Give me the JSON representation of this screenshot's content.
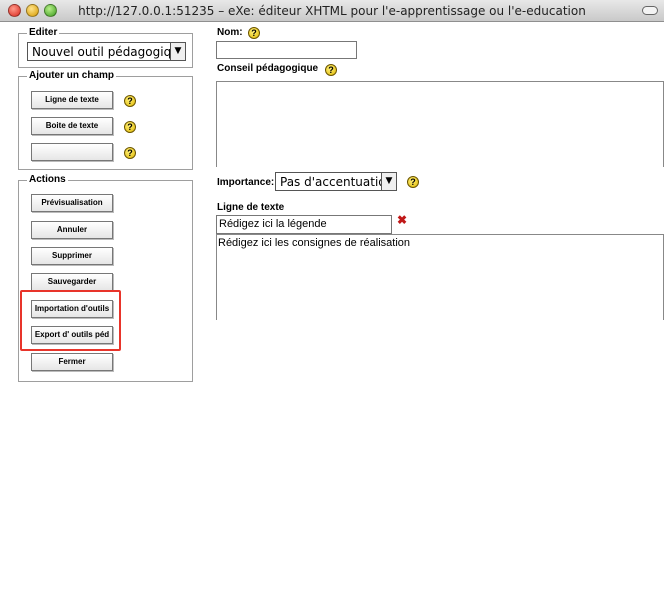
{
  "window": {
    "title": "http://127.0.0.1:51235 – eXe: éditeur XHTML pour l'e-apprentissage ou l'e-education"
  },
  "editer": {
    "legend": "Editer",
    "selected": "Nouvel outil pédagogique",
    "arrow": "▼"
  },
  "ajouter": {
    "legend": "Ajouter un champ",
    "buttons": [
      "Ligne de texte",
      "Boite de texte",
      ""
    ],
    "help": "?"
  },
  "actions": {
    "legend": "Actions",
    "buttons": [
      "Prévisualisation",
      "Annuler",
      "Supprimer",
      "Sauvegarder",
      "Importation d'outils",
      "Export d' outils péd",
      "Fermer"
    ]
  },
  "form": {
    "nom_label": "Nom:",
    "conseil_label": "Conseil pédagogique",
    "importance_label": "Importance:",
    "importance_value": "Pas d'accentuation",
    "ligne_label": "Ligne de texte",
    "legende_value": "Rédigez ici la légende",
    "consignes_value": "Rédigez ici les consignes de réalisation",
    "delete_glyph": "✖"
  },
  "colors": {
    "highlight": "#e8342a",
    "help_icon": "#f2cc00",
    "delete_icon": "#c01818"
  }
}
